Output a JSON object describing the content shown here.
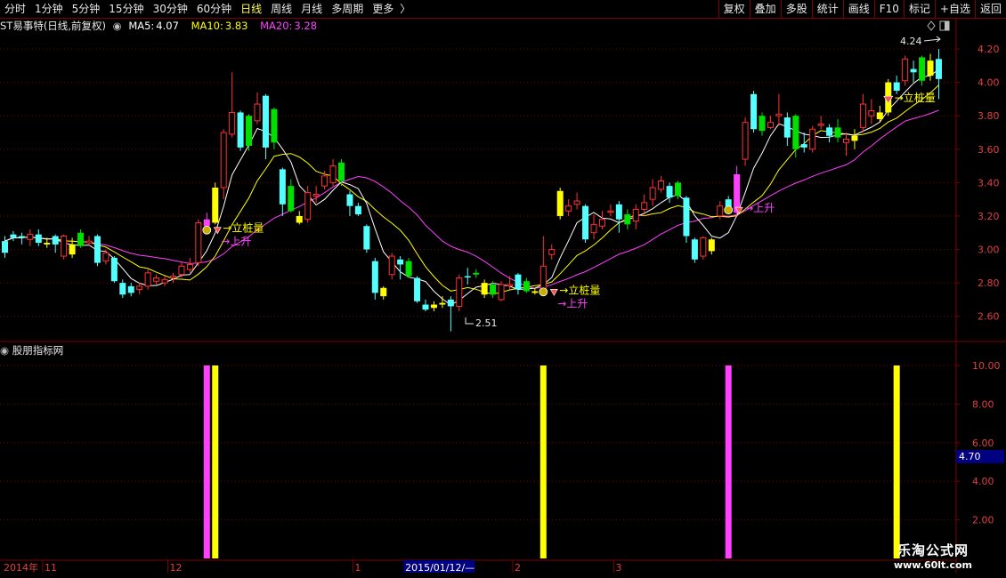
{
  "toolbar": {
    "periods": [
      "分时",
      "1分钟",
      "5分钟",
      "15分钟",
      "30分钟",
      "60分钟",
      "日线",
      "周线",
      "月线",
      "多周期",
      "更多"
    ],
    "active": "日线",
    "more_arrow": "〉",
    "actions": [
      "复权",
      "叠加",
      "多股",
      "统计",
      "画线",
      "F10",
      "标记",
      "+自选",
      "返回"
    ]
  },
  "info": {
    "stock": "ST易事特(日线,前复权)",
    "ma5_label": "MA5:",
    "ma5_value": "4.07",
    "ma10_label": "MA10:",
    "ma10_value": "3.83",
    "ma20_label": "MA20:",
    "ma20_value": "3.28"
  },
  "indicator_panel": {
    "title": "股朋指标网",
    "readout": "4.70"
  },
  "annotations": {
    "high_label": "4.24",
    "low_label": "2.51",
    "marker_pile": "→立桩量",
    "marker_rise": "→上升"
  },
  "date_axis": {
    "year_label": "2014年",
    "labels": [
      {
        "text": "11",
        "day": 1
      },
      {
        "text": "12",
        "day": 20
      },
      {
        "text": "1",
        "day": 42
      },
      {
        "text": "2015/01/12/—",
        "day": 48
      },
      {
        "text": "2",
        "day": 61
      },
      {
        "text": "3",
        "day": 73
      }
    ]
  },
  "watermark": {
    "line1": "乐淘公式网",
    "line2": "www.60lt.com"
  },
  "colors": {
    "up": "#ff3232",
    "down": "#54ffff",
    "green": "#00e000",
    "yellow": "#ffff00",
    "ma5": "#ffffff",
    "ma10": "#ffff00",
    "ma20": "#ff40ff",
    "grid": "#800000"
  },
  "chart_data": [
    {
      "type": "candlestick",
      "price_axis": {
        "ticks": [
          "2.60",
          "2.80",
          "3.00",
          "3.20",
          "3.40",
          "3.60",
          "3.80",
          "4.00",
          "4.20"
        ],
        "ylim": [
          2.46,
          4.28
        ]
      },
      "candles": [
        {
          "o": 2.98,
          "c": 3.05,
          "h": 3.08,
          "l": 2.95,
          "k": "down"
        },
        {
          "o": 3.07,
          "c": 3.09,
          "h": 3.11,
          "l": 3.05,
          "k": "down"
        },
        {
          "o": 3.08,
          "c": 3.07,
          "h": 3.1,
          "l": 3.03,
          "k": "down"
        },
        {
          "o": 3.06,
          "c": 3.09,
          "h": 3.12,
          "l": 3.02,
          "k": "up"
        },
        {
          "o": 3.09,
          "c": 3.04,
          "h": 3.12,
          "l": 3.02,
          "k": "down"
        },
        {
          "o": 3.04,
          "c": 3.03,
          "h": 3.07,
          "l": 3.01,
          "k": "yellow"
        },
        {
          "o": 3.03,
          "c": 3.08,
          "h": 3.09,
          "l": 2.98,
          "k": "down"
        },
        {
          "o": 3.08,
          "c": 2.96,
          "h": 3.09,
          "l": 2.94,
          "k": "up"
        },
        {
          "o": 2.97,
          "c": 3.03,
          "h": 3.07,
          "l": 2.95,
          "k": "yellow"
        },
        {
          "o": 3.1,
          "c": 3.02,
          "h": 3.12,
          "l": 3.01,
          "k": "green"
        },
        {
          "o": 3.05,
          "c": 3.04,
          "h": 3.08,
          "l": 3.02,
          "k": "up"
        },
        {
          "o": 3.08,
          "c": 2.92,
          "h": 3.09,
          "l": 2.9,
          "k": "down"
        },
        {
          "o": 2.98,
          "c": 2.93,
          "h": 3.0,
          "l": 2.91,
          "k": "up"
        },
        {
          "o": 2.95,
          "c": 2.81,
          "h": 2.96,
          "l": 2.8,
          "k": "down"
        },
        {
          "o": 2.8,
          "c": 2.73,
          "h": 2.82,
          "l": 2.71,
          "k": "down"
        },
        {
          "o": 2.78,
          "c": 2.74,
          "h": 2.8,
          "l": 2.72,
          "k": "down"
        },
        {
          "o": 2.76,
          "c": 2.78,
          "h": 2.8,
          "l": 2.73,
          "k": "up"
        },
        {
          "o": 2.78,
          "c": 2.86,
          "h": 2.88,
          "l": 2.76,
          "k": "up"
        },
        {
          "o": 2.83,
          "c": 2.81,
          "h": 2.85,
          "l": 2.79,
          "k": "up"
        },
        {
          "o": 2.8,
          "c": 2.82,
          "h": 2.84,
          "l": 2.78,
          "k": "up"
        },
        {
          "o": 2.83,
          "c": 2.84,
          "h": 2.86,
          "l": 2.8,
          "k": "up"
        },
        {
          "o": 2.85,
          "c": 2.9,
          "h": 2.93,
          "l": 2.83,
          "k": "up"
        },
        {
          "o": 2.91,
          "c": 2.88,
          "h": 2.95,
          "l": 2.86,
          "k": "up"
        },
        {
          "o": 2.92,
          "c": 3.16,
          "h": 3.18,
          "l": 2.9,
          "k": "up"
        },
        {
          "o": 3.14,
          "c": 3.18,
          "h": 3.22,
          "l": 3.1,
          "k": "magenta"
        },
        {
          "o": 3.16,
          "c": 3.37,
          "h": 3.4,
          "l": 3.15,
          "k": "yellow"
        },
        {
          "o": 3.37,
          "c": 3.7,
          "h": 3.72,
          "l": 3.3,
          "k": "up"
        },
        {
          "o": 3.69,
          "c": 3.82,
          "h": 4.06,
          "l": 3.67,
          "k": "up"
        },
        {
          "o": 3.82,
          "c": 3.61,
          "h": 3.83,
          "l": 3.59,
          "k": "down"
        },
        {
          "o": 3.8,
          "c": 3.62,
          "h": 3.81,
          "l": 3.59,
          "k": "green"
        },
        {
          "o": 3.77,
          "c": 3.87,
          "h": 3.94,
          "l": 3.75,
          "k": "up"
        },
        {
          "o": 3.92,
          "c": 3.61,
          "h": 3.93,
          "l": 3.54,
          "k": "down"
        },
        {
          "o": 3.84,
          "c": 3.64,
          "h": 3.85,
          "l": 3.6,
          "k": "green"
        },
        {
          "o": 3.48,
          "c": 3.27,
          "h": 3.49,
          "l": 3.2,
          "k": "down"
        },
        {
          "o": 3.38,
          "c": 3.23,
          "h": 3.42,
          "l": 3.22,
          "k": "green"
        },
        {
          "o": 3.2,
          "c": 3.16,
          "h": 3.23,
          "l": 3.15,
          "k": "yellow"
        },
        {
          "o": 3.18,
          "c": 3.34,
          "h": 3.38,
          "l": 3.16,
          "k": "up"
        },
        {
          "o": 3.32,
          "c": 3.33,
          "h": 3.38,
          "l": 3.28,
          "k": "up"
        },
        {
          "o": 3.38,
          "c": 3.44,
          "h": 3.47,
          "l": 3.36,
          "k": "up"
        },
        {
          "o": 3.4,
          "c": 3.5,
          "h": 3.54,
          "l": 3.38,
          "k": "up"
        },
        {
          "o": 3.52,
          "c": 3.41,
          "h": 3.54,
          "l": 3.38,
          "k": "green"
        },
        {
          "o": 3.33,
          "c": 3.26,
          "h": 3.35,
          "l": 3.2,
          "k": "down"
        },
        {
          "o": 3.26,
          "c": 3.21,
          "h": 3.28,
          "l": 3.2,
          "k": "down"
        },
        {
          "o": 3.14,
          "c": 3.0,
          "h": 3.15,
          "l": 2.98,
          "k": "down"
        },
        {
          "o": 2.93,
          "c": 2.74,
          "h": 2.95,
          "l": 2.7,
          "k": "down"
        },
        {
          "o": 2.77,
          "c": 2.72,
          "h": 2.78,
          "l": 2.7,
          "k": "yellow"
        },
        {
          "o": 2.85,
          "c": 2.96,
          "h": 2.98,
          "l": 2.82,
          "k": "up"
        },
        {
          "o": 2.94,
          "c": 2.91,
          "h": 2.96,
          "l": 2.82,
          "k": "down"
        },
        {
          "o": 2.93,
          "c": 2.84,
          "h": 2.95,
          "l": 2.83,
          "k": "green"
        },
        {
          "o": 2.83,
          "c": 2.69,
          "h": 2.84,
          "l": 2.68,
          "k": "down"
        },
        {
          "o": 2.67,
          "c": 2.64,
          "h": 2.7,
          "l": 2.63,
          "k": "down"
        },
        {
          "o": 2.65,
          "c": 2.67,
          "h": 2.69,
          "l": 2.63,
          "k": "yellow"
        },
        {
          "o": 2.67,
          "c": 2.68,
          "h": 2.72,
          "l": 2.65,
          "k": "yellow"
        },
        {
          "o": 2.7,
          "c": 2.66,
          "h": 2.72,
          "l": 2.51,
          "k": "down"
        },
        {
          "o": 2.66,
          "c": 2.83,
          "h": 2.85,
          "l": 2.63,
          "k": "up"
        },
        {
          "o": 2.84,
          "c": 2.84,
          "h": 2.89,
          "l": 2.79,
          "k": "down"
        },
        {
          "o": 2.85,
          "c": 2.86,
          "h": 2.88,
          "l": 2.83,
          "k": "green"
        },
        {
          "o": 2.8,
          "c": 2.73,
          "h": 2.82,
          "l": 2.71,
          "k": "yellow"
        },
        {
          "o": 2.79,
          "c": 2.73,
          "h": 2.81,
          "l": 2.71,
          "k": "green"
        },
        {
          "o": 2.7,
          "c": 2.79,
          "h": 2.81,
          "l": 2.69,
          "k": "up"
        },
        {
          "o": 2.79,
          "c": 2.79,
          "h": 2.84,
          "l": 2.76,
          "k": "up"
        },
        {
          "o": 2.85,
          "c": 2.76,
          "h": 2.86,
          "l": 2.73,
          "k": "down"
        },
        {
          "o": 2.81,
          "c": 2.75,
          "h": 2.83,
          "l": 2.74,
          "k": "green"
        },
        {
          "o": 2.74,
          "c": 2.75,
          "h": 2.77,
          "l": 2.73,
          "k": "yellow"
        },
        {
          "o": 2.75,
          "c": 2.9,
          "h": 3.08,
          "l": 2.73,
          "k": "up"
        },
        {
          "o": 2.97,
          "c": 3.0,
          "h": 3.03,
          "l": 2.94,
          "k": "up"
        },
        {
          "o": 3.2,
          "c": 3.35,
          "h": 3.37,
          "l": 3.18,
          "k": "yellow"
        },
        {
          "o": 3.23,
          "c": 3.26,
          "h": 3.3,
          "l": 3.2,
          "k": "up"
        },
        {
          "o": 3.27,
          "c": 3.29,
          "h": 3.34,
          "l": 3.24,
          "k": "up"
        },
        {
          "o": 3.26,
          "c": 3.06,
          "h": 3.27,
          "l": 3.04,
          "k": "down"
        },
        {
          "o": 3.1,
          "c": 3.15,
          "h": 3.21,
          "l": 3.06,
          "k": "up"
        },
        {
          "o": 3.14,
          "c": 3.18,
          "h": 3.23,
          "l": 3.12,
          "k": "up"
        },
        {
          "o": 3.23,
          "c": 3.23,
          "h": 3.27,
          "l": 3.2,
          "k": "up"
        },
        {
          "o": 3.27,
          "c": 3.18,
          "h": 3.29,
          "l": 3.1,
          "k": "down"
        },
        {
          "o": 3.21,
          "c": 3.15,
          "h": 3.24,
          "l": 3.12,
          "k": "green"
        },
        {
          "o": 3.17,
          "c": 3.24,
          "h": 3.27,
          "l": 3.12,
          "k": "up"
        },
        {
          "o": 3.24,
          "c": 3.28,
          "h": 3.33,
          "l": 3.2,
          "k": "up"
        },
        {
          "o": 3.3,
          "c": 3.37,
          "h": 3.42,
          "l": 3.26,
          "k": "up"
        },
        {
          "o": 3.41,
          "c": 3.36,
          "h": 3.44,
          "l": 3.34,
          "k": "up"
        },
        {
          "o": 3.38,
          "c": 3.31,
          "h": 3.4,
          "l": 3.28,
          "k": "down"
        },
        {
          "o": 3.4,
          "c": 3.32,
          "h": 3.41,
          "l": 3.3,
          "k": "green"
        },
        {
          "o": 3.31,
          "c": 3.08,
          "h": 3.32,
          "l": 3.04,
          "k": "down"
        },
        {
          "o": 3.06,
          "c": 2.94,
          "h": 3.07,
          "l": 2.92,
          "k": "down"
        },
        {
          "o": 2.96,
          "c": 3.07,
          "h": 3.08,
          "l": 2.94,
          "k": "up"
        },
        {
          "o": 3.06,
          "c": 2.99,
          "h": 3.07,
          "l": 2.97,
          "k": "yellow"
        },
        {
          "o": 3.2,
          "c": 3.26,
          "h": 3.29,
          "l": 3.18,
          "k": "up"
        },
        {
          "o": 3.3,
          "c": 3.24,
          "h": 3.32,
          "l": 3.22,
          "k": "down"
        },
        {
          "o": 3.22,
          "c": 3.45,
          "h": 3.5,
          "l": 3.2,
          "k": "magenta"
        },
        {
          "o": 3.54,
          "c": 3.76,
          "h": 3.79,
          "l": 3.5,
          "k": "up"
        },
        {
          "o": 3.93,
          "c": 3.72,
          "h": 3.95,
          "l": 3.7,
          "k": "down"
        },
        {
          "o": 3.8,
          "c": 3.71,
          "h": 3.82,
          "l": 3.68,
          "k": "green"
        },
        {
          "o": 3.73,
          "c": 3.76,
          "h": 3.8,
          "l": 3.72,
          "k": "up"
        },
        {
          "o": 3.8,
          "c": 3.81,
          "h": 3.93,
          "l": 3.74,
          "k": "up"
        },
        {
          "o": 3.79,
          "c": 3.67,
          "h": 3.82,
          "l": 3.62,
          "k": "down"
        },
        {
          "o": 3.8,
          "c": 3.6,
          "h": 3.81,
          "l": 3.55,
          "k": "green"
        },
        {
          "o": 3.63,
          "c": 3.61,
          "h": 3.7,
          "l": 3.58,
          "k": "down"
        },
        {
          "o": 3.6,
          "c": 3.72,
          "h": 3.74,
          "l": 3.58,
          "k": "up"
        },
        {
          "o": 3.75,
          "c": 3.75,
          "h": 3.8,
          "l": 3.72,
          "k": "up"
        },
        {
          "o": 3.73,
          "c": 3.68,
          "h": 3.75,
          "l": 3.64,
          "k": "down"
        },
        {
          "o": 3.73,
          "c": 3.67,
          "h": 3.78,
          "l": 3.64,
          "k": "green"
        },
        {
          "o": 3.66,
          "c": 3.64,
          "h": 3.7,
          "l": 3.56,
          "k": "up"
        },
        {
          "o": 3.65,
          "c": 3.68,
          "h": 3.72,
          "l": 3.6,
          "k": "yellow"
        },
        {
          "o": 3.73,
          "c": 3.87,
          "h": 3.93,
          "l": 3.7,
          "k": "up"
        },
        {
          "o": 3.83,
          "c": 3.8,
          "h": 3.9,
          "l": 3.75,
          "k": "up"
        },
        {
          "o": 3.78,
          "c": 3.82,
          "h": 3.86,
          "l": 3.76,
          "k": "yellow"
        },
        {
          "o": 3.82,
          "c": 4.0,
          "h": 4.02,
          "l": 3.8,
          "k": "yellow"
        },
        {
          "o": 4.0,
          "c": 3.95,
          "h": 4.04,
          "l": 3.93,
          "k": "down"
        },
        {
          "o": 4.01,
          "c": 4.14,
          "h": 4.16,
          "l": 3.98,
          "k": "up"
        },
        {
          "o": 4.08,
          "c": 4.06,
          "h": 4.13,
          "l": 4.0,
          "k": "down"
        },
        {
          "o": 4.15,
          "c": 4.01,
          "h": 4.16,
          "l": 3.98,
          "k": "green"
        },
        {
          "o": 4.13,
          "c": 4.04,
          "h": 4.17,
          "l": 4.01,
          "k": "yellow"
        },
        {
          "o": 4.02,
          "c": 4.14,
          "h": 4.2,
          "l": 3.9,
          "k": "down"
        }
      ],
      "signals": [
        {
          "day": 24,
          "marker": "pile",
          "label": "pile",
          "rise": true
        },
        {
          "day": 64,
          "marker": "pile",
          "label": "pile",
          "rise": true
        },
        {
          "day": 86,
          "marker": "pile",
          "label": "rise",
          "rise": false
        },
        {
          "day": 105,
          "marker": "gem",
          "label": "pile",
          "rise": false
        }
      ]
    },
    {
      "type": "bar",
      "value_axis": {
        "ticks": [
          "2.00",
          "4.00",
          "6.00",
          "8.00",
          "10.00"
        ],
        "ylim": [
          0,
          10.6
        ]
      },
      "series": [
        {
          "color": "magenta",
          "points": [
            {
              "day": 24,
              "value": 10
            },
            {
              "day": 86,
              "value": 10
            }
          ]
        },
        {
          "color": "yellow",
          "points": [
            {
              "day": 25,
              "value": 10
            },
            {
              "day": 64,
              "value": 10
            },
            {
              "day": 106,
              "value": 10
            }
          ]
        }
      ]
    }
  ]
}
